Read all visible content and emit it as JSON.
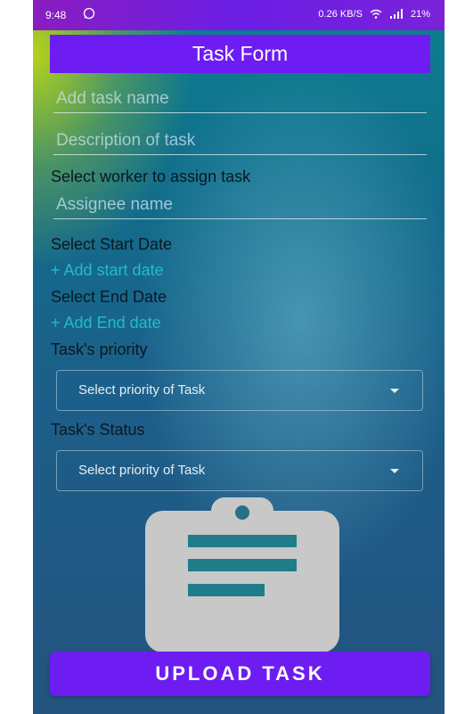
{
  "status_bar": {
    "time": "9:48",
    "right_text": "0.26 KB/S",
    "battery": "21%"
  },
  "header": {
    "title": "Task Form"
  },
  "form": {
    "task_name_placeholder": "Add task name",
    "description_placeholder": "Description of task",
    "assign_label": "Select worker to assign task",
    "assignee_placeholder": "Assignee name",
    "start_date_label": "Select Start Date",
    "start_date_link": "+ Add start date",
    "end_date_label": "Select End Date",
    "end_date_link": "+ Add End date",
    "priority_label": "Task's priority",
    "priority_select": "Select priority of Task",
    "status_label": "Task's Status",
    "status_select": "Select priority of Task"
  },
  "icons": {
    "clipboard": "clipboard-icon"
  },
  "actions": {
    "upload_label": "UPLOAD TASK"
  },
  "colors": {
    "accent": "#6d1df2",
    "link": "#25c3d6"
  }
}
